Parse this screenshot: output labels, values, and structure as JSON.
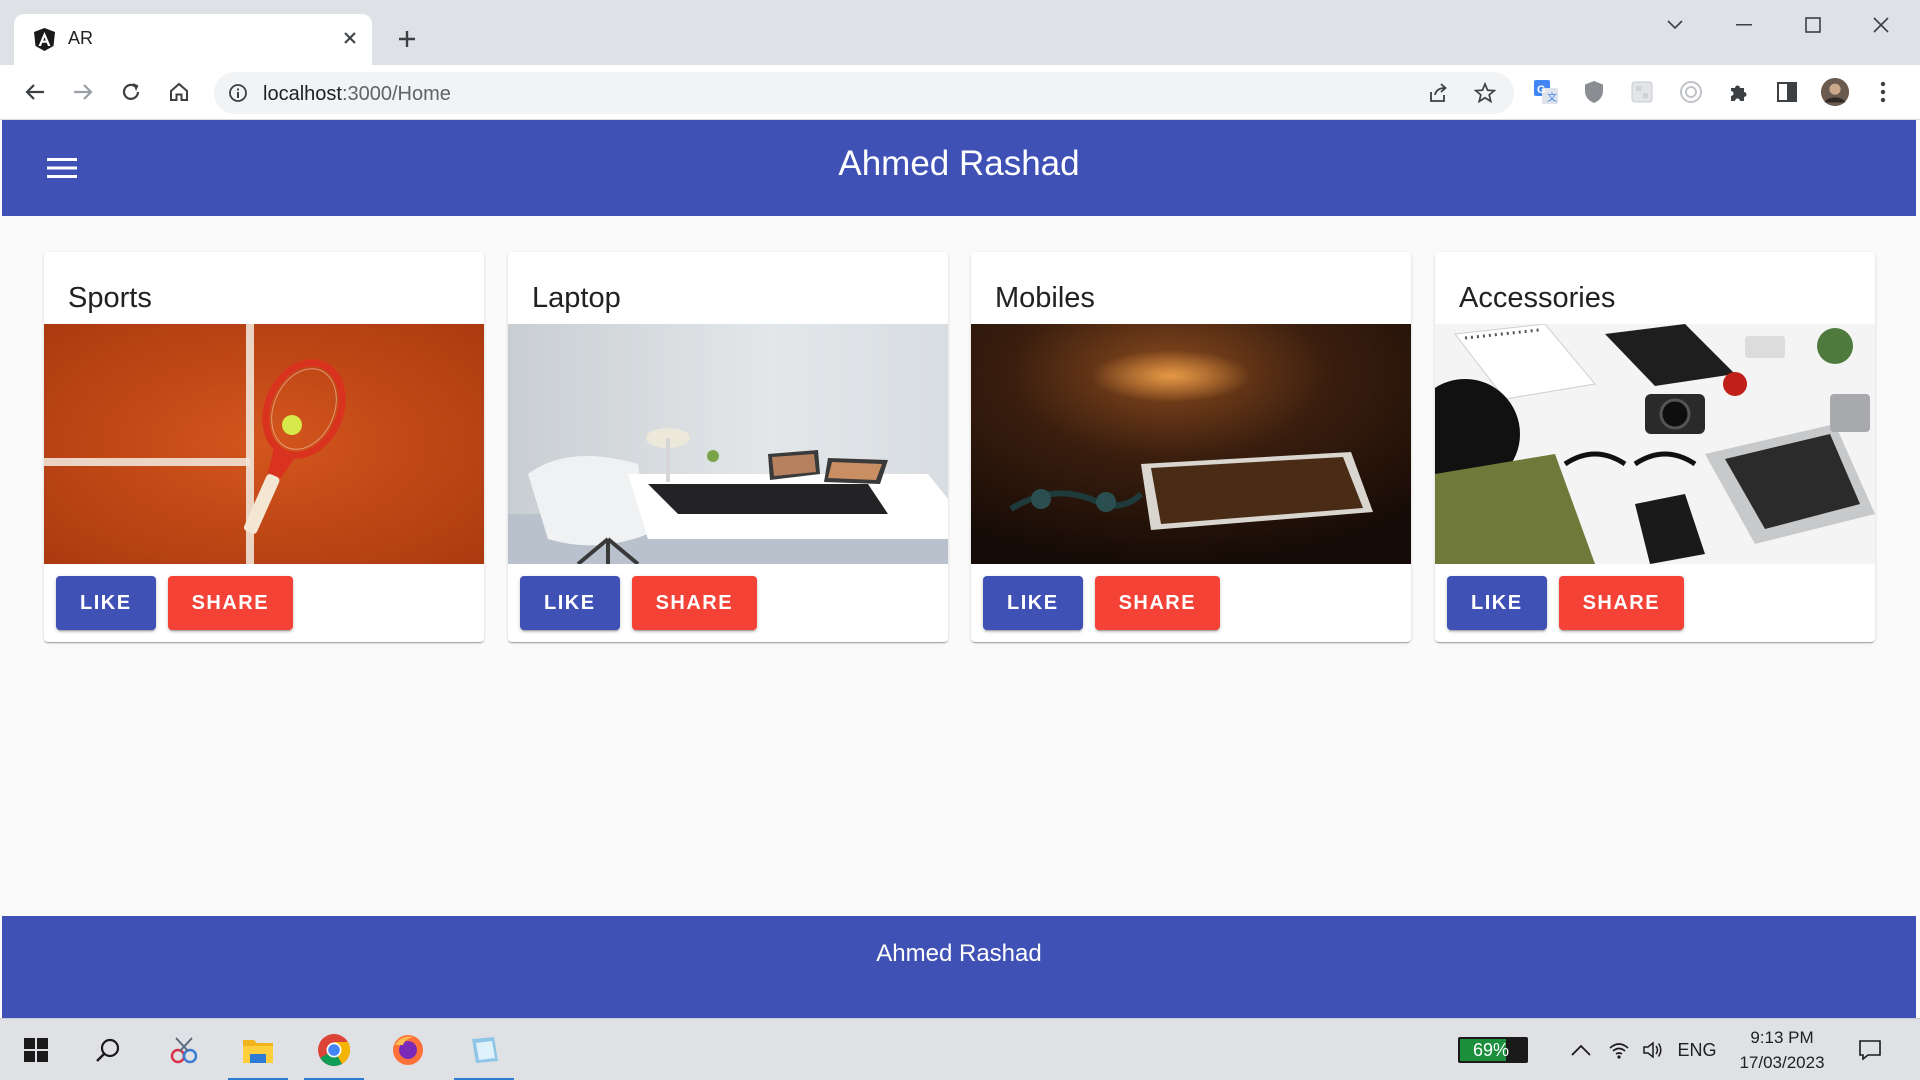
{
  "browser": {
    "tab_title": "AR",
    "url_host": "localhost",
    "url_path": ":3000/Home",
    "icons": [
      "back-icon",
      "forward-icon",
      "reload-icon",
      "home-icon",
      "info-icon",
      "share-icon",
      "star-icon",
      "google-translate-icon",
      "shield-icon",
      "extension-icon",
      "puzzle-icon",
      "side-panel-icon",
      "profile-avatar",
      "more-menu-icon"
    ]
  },
  "app": {
    "title": "Ahmed Rashad",
    "footer": "Ahmed Rashad",
    "colors": {
      "primary": "#3f51b5",
      "accent": "#f44336"
    }
  },
  "cards": [
    {
      "title": "Sports",
      "image": "tennis racket on clay court",
      "like": "LIKE",
      "share": "SHARE"
    },
    {
      "title": "Laptop",
      "image": "laptop on white desk",
      "like": "LIKE",
      "share": "SHARE"
    },
    {
      "title": "Mobiles",
      "image": "tablet on wooden table",
      "like": "LIKE",
      "share": "SHARE"
    },
    {
      "title": "Accessories",
      "image": "flat lay of gadgets and clothes",
      "like": "LIKE",
      "share": "SHARE"
    }
  ],
  "taskbar": {
    "battery": "69%",
    "battery_level": 0.69,
    "language": "ENG",
    "time": "9:13 PM",
    "date": "17/03/2023"
  }
}
